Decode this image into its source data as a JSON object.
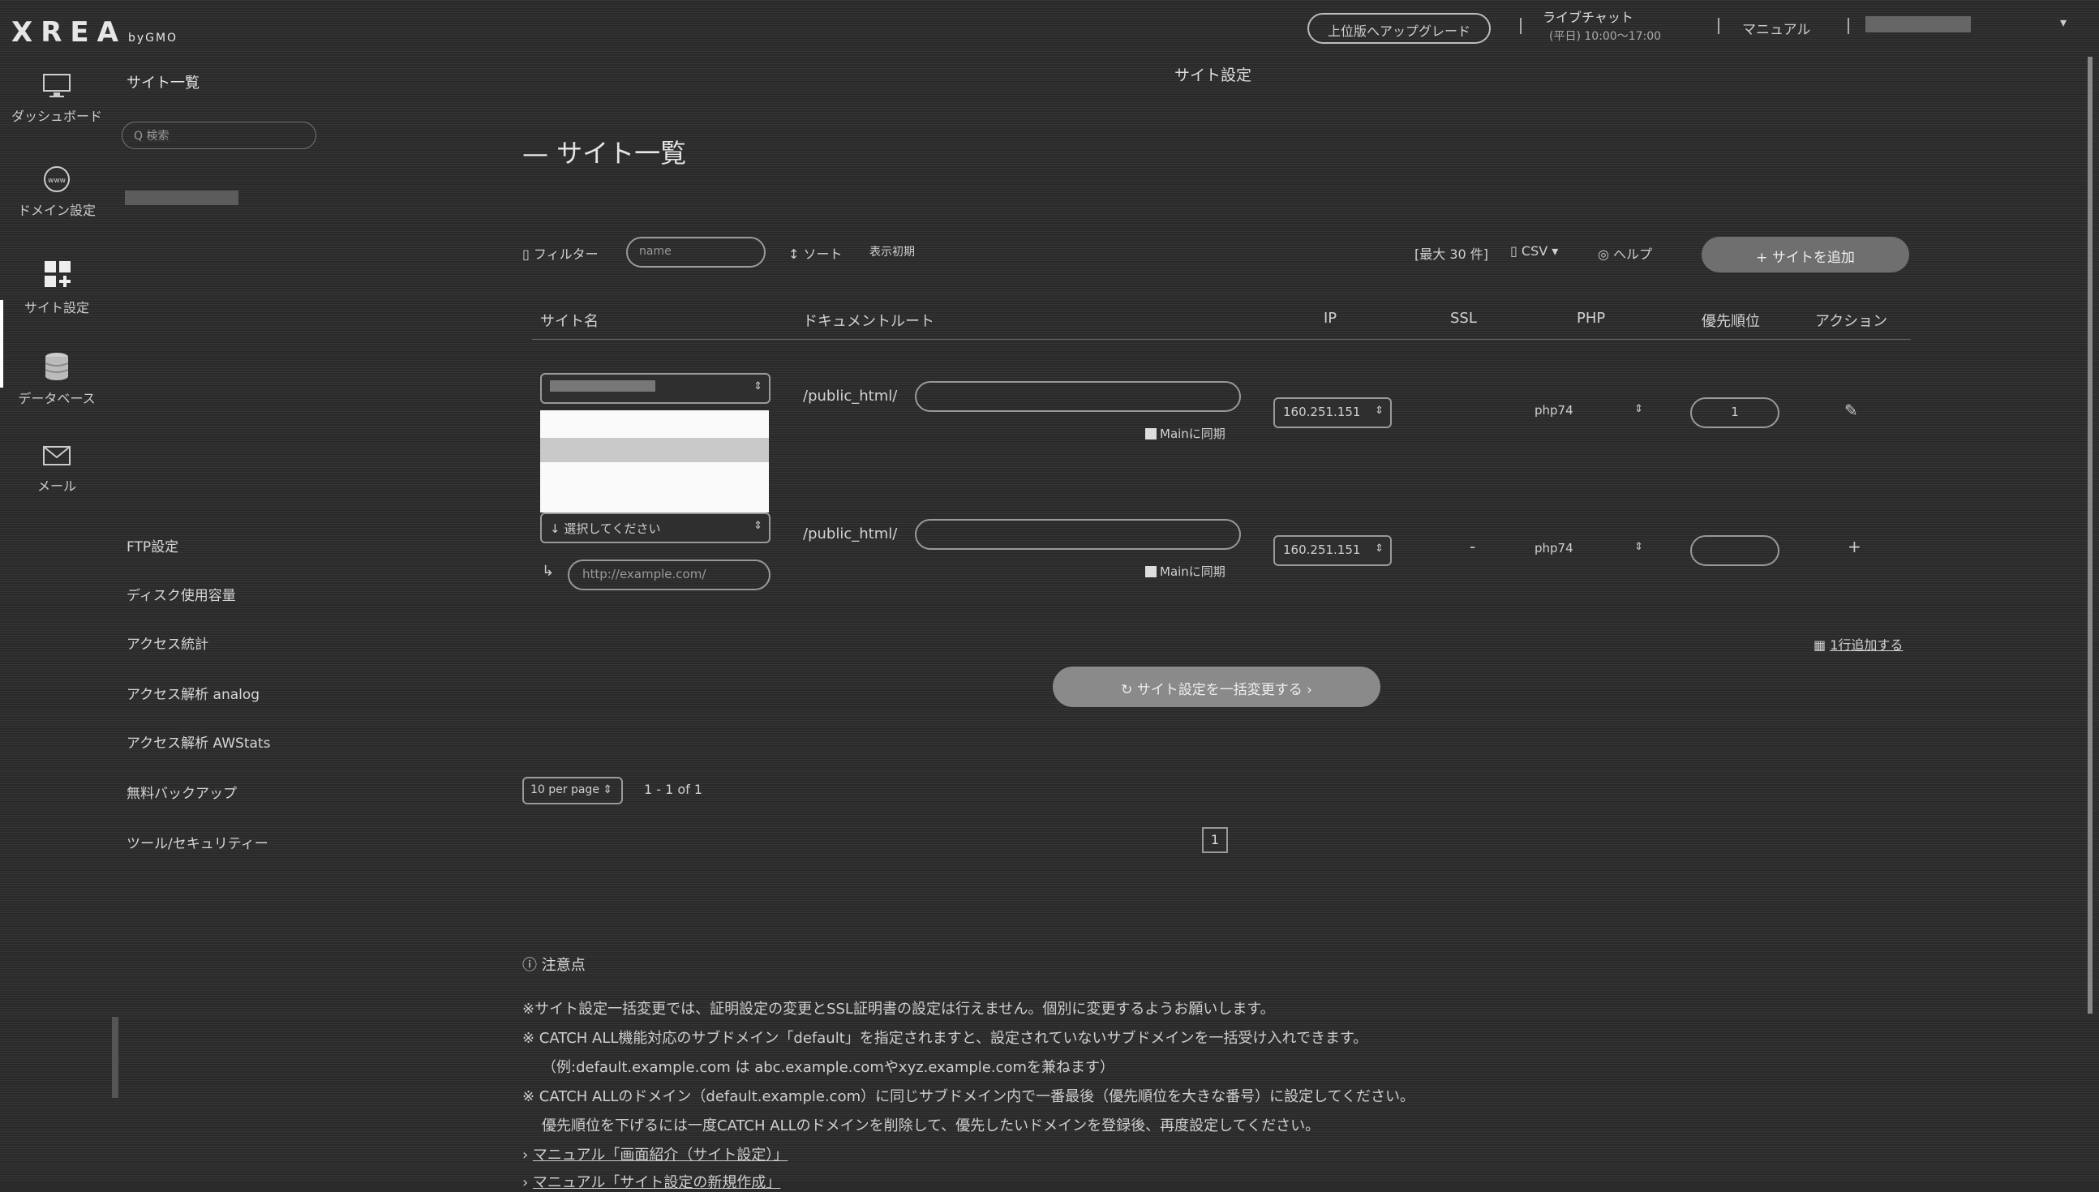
{
  "header": {
    "logo": "XREA",
    "logo_suffix": "byGMO",
    "upgrade_button": "上位版へアップグレード",
    "chat_title": "ライブチャット",
    "chat_hours": "(平日) 10:00～17:00",
    "manual_link": "マニュアル"
  },
  "rail": [
    {
      "label": "ダッシュボード",
      "icon": "monitor-icon"
    },
    {
      "label": "ドメイン設定",
      "icon": "www-globe-icon"
    },
    {
      "label": "サイト設定",
      "icon": "site-grid-icon",
      "active": true
    },
    {
      "label": "データベース",
      "icon": "database-icon"
    },
    {
      "label": "メール",
      "icon": "mail-icon"
    }
  ],
  "sidenav": {
    "title": "サイト一覧",
    "search_placeholder": "Q 検索",
    "items": [
      "FTP設定",
      "ディスク使用容量",
      "アクセス統計",
      "アクセス解析 analog",
      "アクセス解析 AWStats",
      "無料バックアップ",
      "ツール/セキュリティー"
    ]
  },
  "page": {
    "section_title": "サイト設定",
    "title": "サイト一覧",
    "toolbar": {
      "filter_label": "フィルター",
      "filter_placeholder": "name",
      "sort_label": "ソート",
      "reset_label": "表示初期",
      "bulk_select": "[最大 30 件]",
      "csv": "CSV",
      "help": "ヘルプ",
      "add_button": "サイトを追加"
    },
    "columns": [
      "サイト名",
      "ドキュメントルート",
      "IP",
      "SSL",
      "PHP",
      "優先順位",
      "アクション"
    ],
    "rows": [
      {
        "doc_root_prefix": "/public_html/",
        "checkbox_label": "Mainに同期",
        "ip": "160.251.151",
        "ssl": "",
        "php": "php74",
        "priority": "1"
      },
      {
        "site_select": "選択してください",
        "doc_root_prefix": "/public_html/",
        "checkbox_label": "Mainに同期",
        "ip": "160.251.151",
        "ssl": "-",
        "php": "php74",
        "priority": "",
        "url_placeholder": "http://example.com/"
      }
    ],
    "add_row_link": "1行追加する",
    "bulk_button": "サイト設定を一括変更する",
    "pagination": {
      "per_page": "10 per page",
      "range": "1 - 1 of 1",
      "current_page": "1"
    },
    "notes": {
      "title": "注意点",
      "lines": [
        "※サイト設定一括変更では、証明設定の変更とSSL証明書の設定は行えません。個別に変更するようお願いします。",
        "※ CATCH ALL機能対応のサブドメイン「default」を指定されますと、設定されていないサブドメインを一括受け入れできます。",
        "（例:default.example.com は abc.example.comやxyz.example.comを兼ねます）",
        "※ CATCH ALLのドメイン（default.example.com）に同じサブドメイン内で一番最後（優先順位を大きな番号）に設定してください。",
        "優先順位を下げるには一度CATCH ALLのドメインを削除して、優先したいドメインを登録後、再度設定してください。"
      ],
      "links": [
        "マニュアル「画面紹介（サイト設定）」",
        "マニュアル「サイト設定の新規作成」"
      ]
    }
  }
}
